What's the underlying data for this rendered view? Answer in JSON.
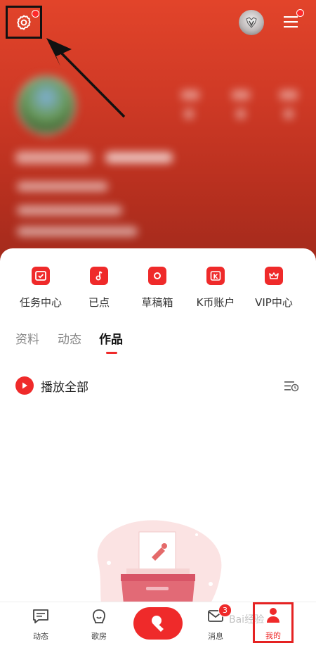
{
  "shortcuts": [
    {
      "label": "任务中心",
      "icon": "task-center-icon"
    },
    {
      "label": "已点",
      "icon": "music-note-icon"
    },
    {
      "label": "草稿箱",
      "icon": "draft-box-icon"
    },
    {
      "label": "K币账户",
      "icon": "k-coin-icon"
    },
    {
      "label": "VIP中心",
      "icon": "crown-icon"
    }
  ],
  "tabs": [
    "资料",
    "动态",
    "作品"
  ],
  "active_tab": "作品",
  "play_all": {
    "label": "播放全部"
  },
  "kcoin_letter": "K",
  "bottom_nav": {
    "items": [
      {
        "label": "动态",
        "icon": "feed-icon"
      },
      {
        "label": "歌房",
        "icon": "microphone-icon"
      },
      {
        "label": "消息",
        "icon": "mail-icon",
        "badge": "3"
      },
      {
        "label": "我的",
        "icon": "profile-icon"
      }
    ]
  },
  "watermark": "Bai经验",
  "colors": {
    "accent": "#ef2a2a",
    "header": "#d03a26"
  }
}
